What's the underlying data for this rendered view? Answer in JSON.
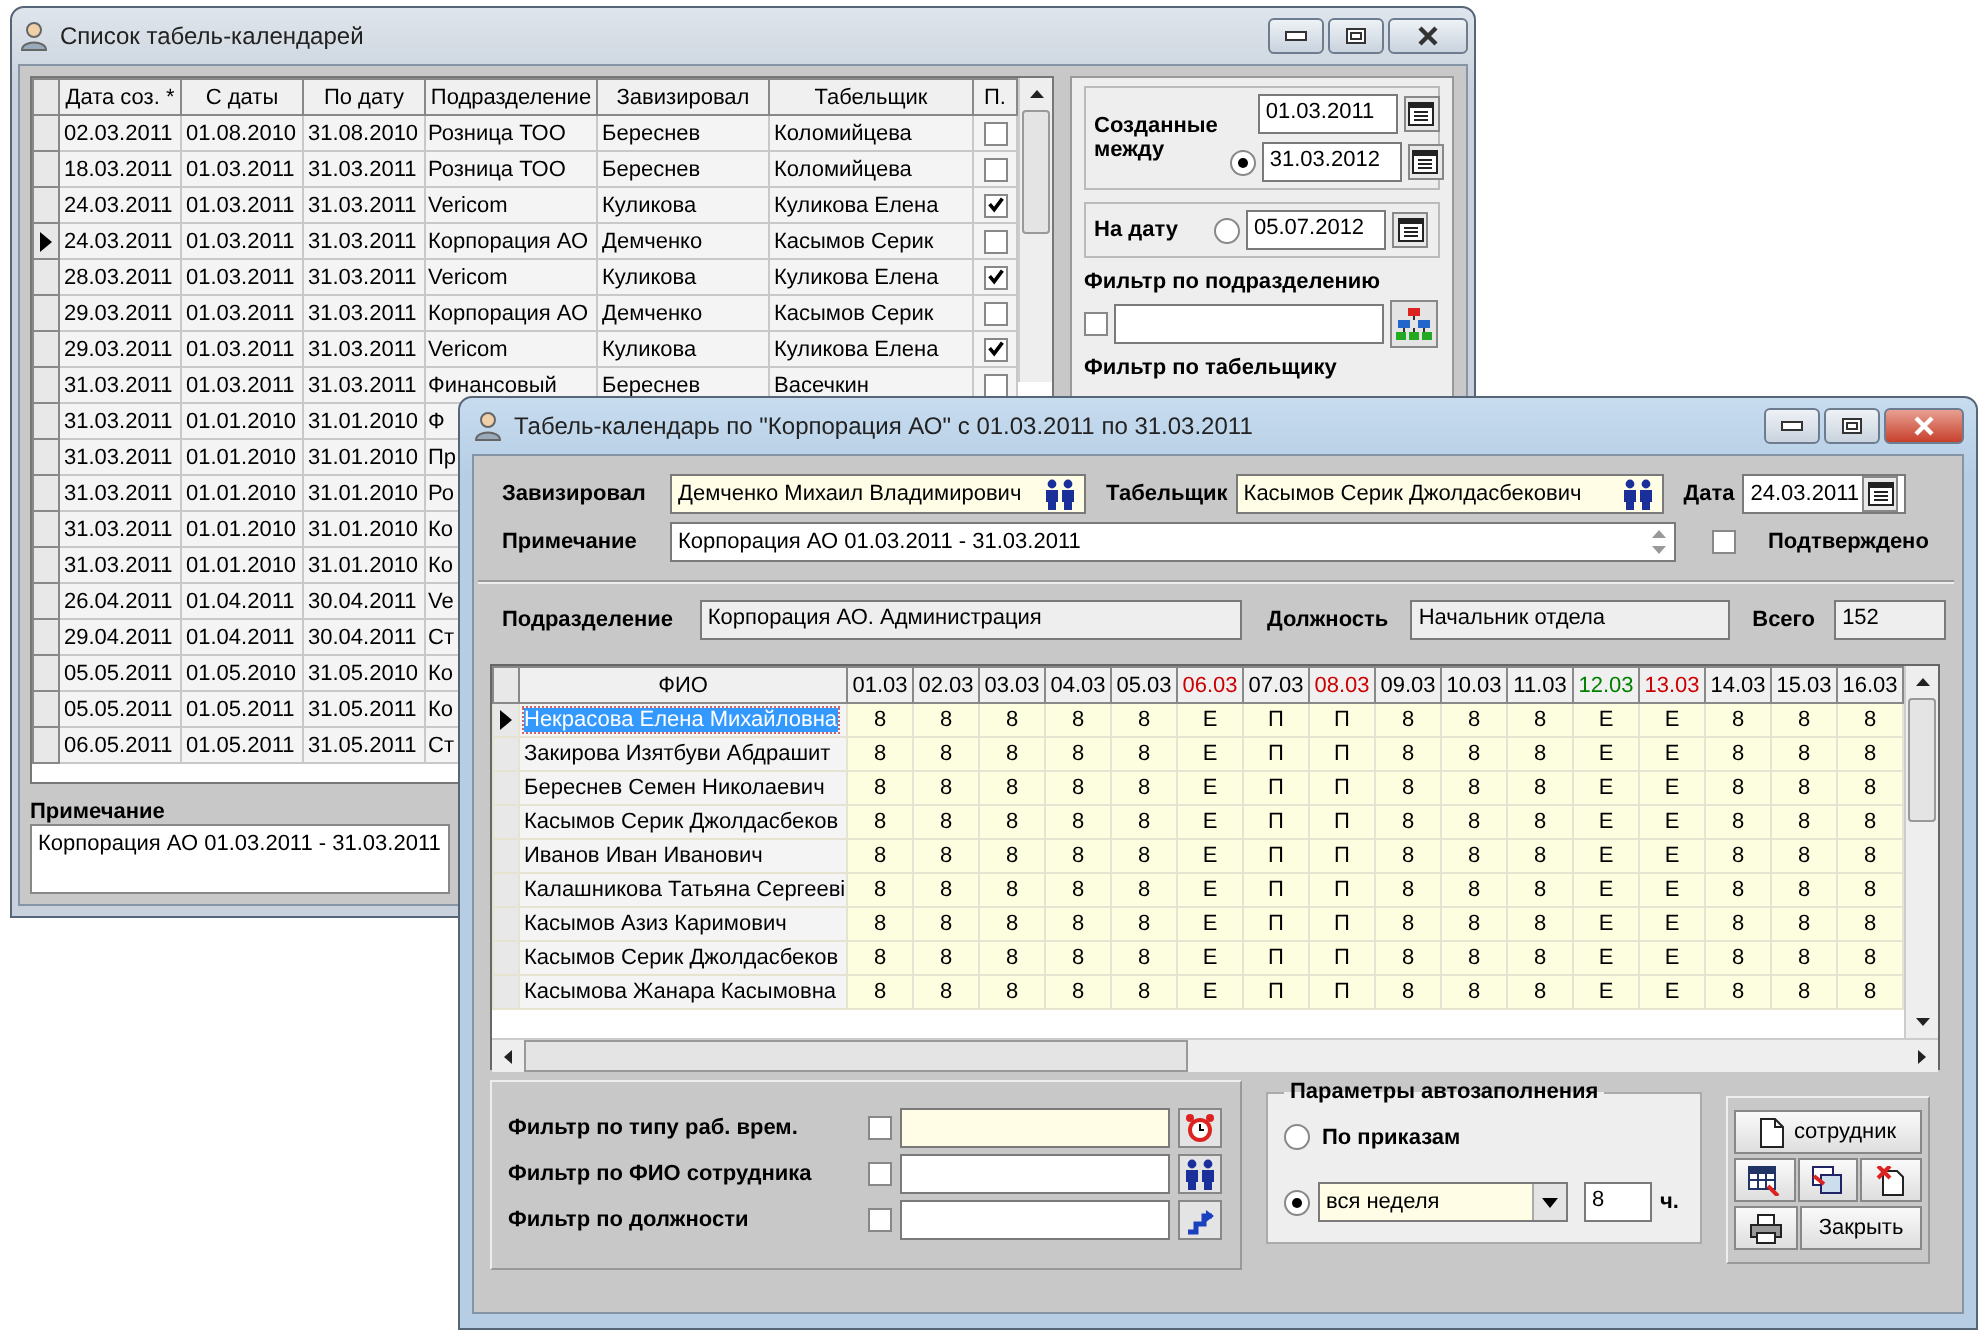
{
  "list_window": {
    "title": "Список табель-календарей",
    "columns": [
      "Дата соз. *",
      "С даты",
      "По дату",
      "Подразделение",
      "Завизировал",
      "Табельщик",
      "П."
    ],
    "rows": [
      {
        "selected": false,
        "cells": [
          "02.03.2011",
          "01.08.2010",
          "31.08.2010",
          "Розница ТОО",
          "Береснев",
          "Коломийцева"
        ],
        "confirmed": false
      },
      {
        "selected": false,
        "cells": [
          "18.03.2011",
          "01.03.2011",
          "31.03.2011",
          "Розница ТОО",
          "Береснев",
          "Коломийцева"
        ],
        "confirmed": false
      },
      {
        "selected": false,
        "cells": [
          "24.03.2011",
          "01.03.2011",
          "31.03.2011",
          "Vericom",
          "Куликова",
          "Куликова Елена"
        ],
        "confirmed": true
      },
      {
        "selected": true,
        "cells": [
          "24.03.2011",
          "01.03.2011",
          "31.03.2011",
          "Корпорация АО",
          "Демченко",
          "Касымов Серик"
        ],
        "confirmed": false
      },
      {
        "selected": false,
        "cells": [
          "28.03.2011",
          "01.03.2011",
          "31.03.2011",
          "Vericom",
          "Куликова",
          "Куликова Елена"
        ],
        "confirmed": true
      },
      {
        "selected": false,
        "cells": [
          "29.03.2011",
          "01.03.2011",
          "31.03.2011",
          "Корпорация АО",
          "Демченко",
          "Касымов Серик"
        ],
        "confirmed": false
      },
      {
        "selected": false,
        "cells": [
          "29.03.2011",
          "01.03.2011",
          "31.03.2011",
          "Vericom",
          "Куликова",
          "Куликова Елена"
        ],
        "confirmed": true
      },
      {
        "selected": false,
        "cells": [
          "31.03.2011",
          "01.03.2011",
          "31.03.2011",
          "Финансовый",
          "Береснев",
          "Васечкин"
        ],
        "confirmed": false
      },
      {
        "selected": false,
        "cells": [
          "31.03.2011",
          "01.01.2010",
          "31.01.2010",
          "Ф"
        ]
      },
      {
        "selected": false,
        "cells": [
          "31.03.2011",
          "01.01.2010",
          "31.01.2010",
          "Пр"
        ]
      },
      {
        "selected": false,
        "cells": [
          "31.03.2011",
          "01.01.2010",
          "31.01.2010",
          "Ро"
        ]
      },
      {
        "selected": false,
        "cells": [
          "31.03.2011",
          "01.01.2010",
          "31.01.2010",
          "Ко"
        ]
      },
      {
        "selected": false,
        "cells": [
          "31.03.2011",
          "01.01.2010",
          "31.01.2010",
          "Ко"
        ]
      },
      {
        "selected": false,
        "cells": [
          "26.04.2011",
          "01.04.2011",
          "30.04.2011",
          "Ve"
        ]
      },
      {
        "selected": false,
        "cells": [
          "29.04.2011",
          "01.04.2011",
          "30.04.2011",
          "Ст"
        ]
      },
      {
        "selected": false,
        "cells": [
          "05.05.2011",
          "01.05.2010",
          "31.05.2010",
          "Ко"
        ]
      },
      {
        "selected": false,
        "cells": [
          "05.05.2011",
          "01.05.2011",
          "31.05.2011",
          "Ко"
        ]
      },
      {
        "selected": false,
        "cells": [
          "06.05.2011",
          "01.05.2011",
          "31.05.2011",
          "Ст"
        ]
      }
    ],
    "created_between": {
      "label": "Созданные между",
      "from": "01.03.2011",
      "to": "31.03.2012",
      "selected": true
    },
    "on_date": {
      "label": "На дату",
      "value": "05.07.2012",
      "selected": false
    },
    "department_filter": {
      "label": "Фильтр по подразделению",
      "checked": false
    },
    "timekeeper_filter_label": "Фильтр по табельщику",
    "note": {
      "label": "Примечание",
      "value": "Корпорация АО 01.03.2011 - 31.03.2011"
    }
  },
  "timesheet_window": {
    "title": "Табель-календарь по \"Корпорация АО\" с 01.03.2011 по 31.03.2011",
    "approved_by": {
      "label": "Завизировал",
      "value": "Демченко Михаил Владимирович"
    },
    "timekeeper": {
      "label": "Табельщик",
      "value": "Касымов Серик Джолдасбекович"
    },
    "date": {
      "label": "Дата",
      "value": "24.03.2011"
    },
    "note": {
      "label": "Примечание",
      "value": "Корпорация АО 01.03.2011 - 31.03.2011"
    },
    "confirmed": {
      "label": "Подтверждено",
      "checked": false
    },
    "department": {
      "label": "Подразделение",
      "value": "Корпорация АО. Администрация"
    },
    "position": {
      "label": "Должность",
      "value": "Начальник отдела"
    },
    "total": {
      "label": "Всего",
      "value": "152"
    },
    "grid": {
      "name_column": "ФИО",
      "days": [
        {
          "label": "01.03",
          "color": "#000000"
        },
        {
          "label": "02.03",
          "color": "#000000"
        },
        {
          "label": "03.03",
          "color": "#000000"
        },
        {
          "label": "04.03",
          "color": "#000000"
        },
        {
          "label": "05.03",
          "color": "#000000"
        },
        {
          "label": "06.03",
          "color": "#cc0000"
        },
        {
          "label": "07.03",
          "color": "#000000"
        },
        {
          "label": "08.03",
          "color": "#cc0000"
        },
        {
          "label": "09.03",
          "color": "#000000"
        },
        {
          "label": "10.03",
          "color": "#000000"
        },
        {
          "label": "11.03",
          "color": "#000000"
        },
        {
          "label": "12.03",
          "color": "#008000"
        },
        {
          "label": "13.03",
          "color": "#cc0000"
        },
        {
          "label": "14.03",
          "color": "#000000"
        },
        {
          "label": "15.03",
          "color": "#000000"
        },
        {
          "label": "16.03",
          "color": "#000000"
        }
      ],
      "rows": [
        {
          "name": "Некрасова Елена Михайловна",
          "selected": true,
          "cells": [
            "8",
            "8",
            "8",
            "8",
            "8",
            "Е",
            "П",
            "П",
            "8",
            "8",
            "8",
            "Е",
            "Е",
            "8",
            "8",
            "8"
          ]
        },
        {
          "name": "Закирова  Изятбуви Абдрашит",
          "selected": false,
          "cells": [
            "8",
            "8",
            "8",
            "8",
            "8",
            "Е",
            "П",
            "П",
            "8",
            "8",
            "8",
            "Е",
            "Е",
            "8",
            "8",
            "8"
          ]
        },
        {
          "name": "Береснев  Семен Николаевич",
          "selected": false,
          "cells": [
            "8",
            "8",
            "8",
            "8",
            "8",
            "Е",
            "П",
            "П",
            "8",
            "8",
            "8",
            "Е",
            "Е",
            "8",
            "8",
            "8"
          ]
        },
        {
          "name": "Касымов Серик Джолдасбеков",
          "selected": false,
          "cells": [
            "8",
            "8",
            "8",
            "8",
            "8",
            "Е",
            "П",
            "П",
            "8",
            "8",
            "8",
            "Е",
            "Е",
            "8",
            "8",
            "8"
          ]
        },
        {
          "name": "Иванов Иван Иванович",
          "selected": false,
          "cells": [
            "8",
            "8",
            "8",
            "8",
            "8",
            "Е",
            "П",
            "П",
            "8",
            "8",
            "8",
            "Е",
            "Е",
            "8",
            "8",
            "8"
          ]
        },
        {
          "name": "Калашникова Татьяна Сергееві",
          "selected": false,
          "cells": [
            "8",
            "8",
            "8",
            "8",
            "8",
            "Е",
            "П",
            "П",
            "8",
            "8",
            "8",
            "Е",
            "Е",
            "8",
            "8",
            "8"
          ]
        },
        {
          "name": "Касымов Азиз Каримович",
          "selected": false,
          "cells": [
            "8",
            "8",
            "8",
            "8",
            "8",
            "Е",
            "П",
            "П",
            "8",
            "8",
            "8",
            "Е",
            "Е",
            "8",
            "8",
            "8"
          ]
        },
        {
          "name": "Касымов Серик Джолдасбеков",
          "selected": false,
          "cells": [
            "8",
            "8",
            "8",
            "8",
            "8",
            "Е",
            "П",
            "П",
            "8",
            "8",
            "8",
            "Е",
            "Е",
            "8",
            "8",
            "8"
          ]
        },
        {
          "name": "Касымова Жанара Касымовна",
          "selected": false,
          "cells": [
            "8",
            "8",
            "8",
            "8",
            "8",
            "Е",
            "П",
            "П",
            "8",
            "8",
            "8",
            "Е",
            "Е",
            "8",
            "8",
            "8"
          ]
        }
      ]
    },
    "filters": [
      {
        "label": "Фильтр по типу раб. врем.",
        "checked": false
      },
      {
        "label": "Фильтр по ФИО сотрудника",
        "checked": false
      },
      {
        "label": "Фильтр по должности",
        "checked": false
      }
    ],
    "autofill": {
      "title": "Параметры автозаполнения",
      "by_orders": {
        "label": "По приказам",
        "selected": false
      },
      "schedule": {
        "value": "вся неделя",
        "selected": true
      },
      "hours": "8",
      "hours_unit": "ч."
    },
    "buttons": {
      "employee": "сотрудник",
      "close": "Закрыть"
    }
  }
}
